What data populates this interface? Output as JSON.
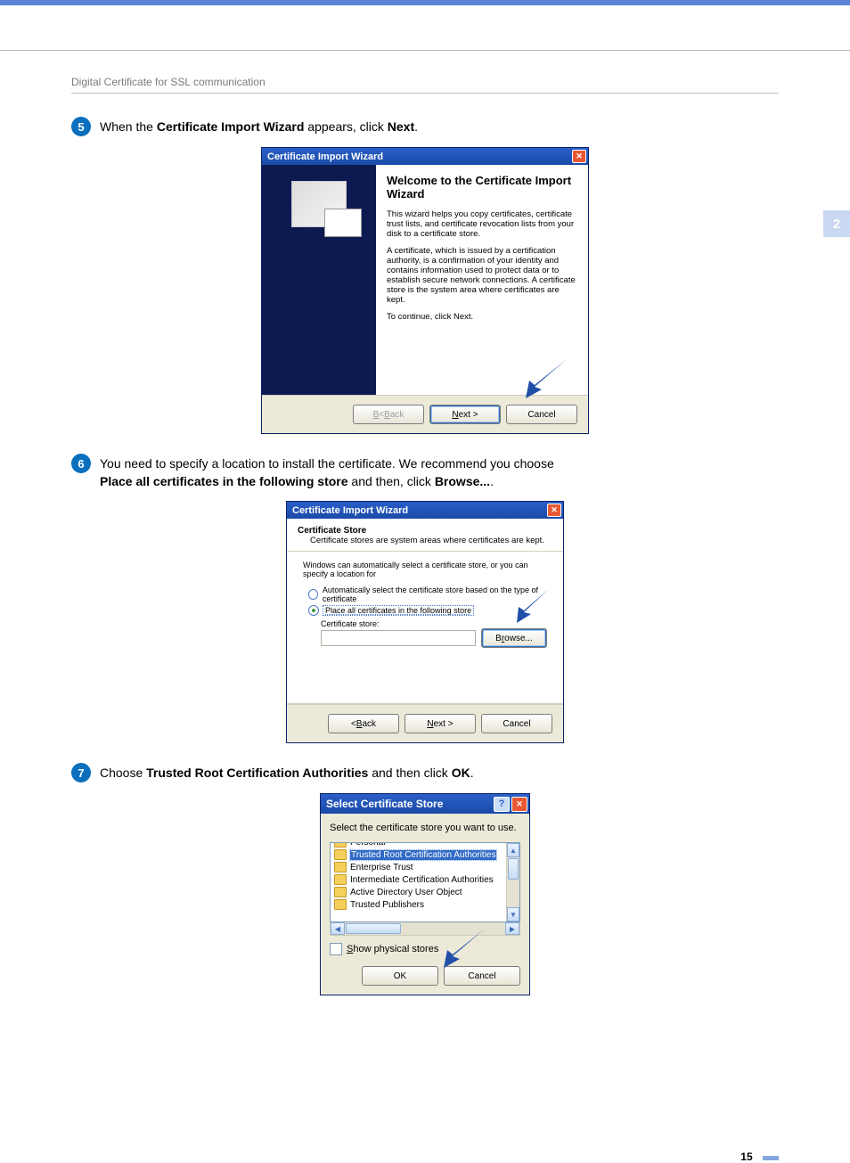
{
  "page": {
    "section_header": "Digital Certificate for SSL communication",
    "side_tab": "2",
    "page_number": "15"
  },
  "step5": {
    "number": "5",
    "prefix": "When the ",
    "bold1": "Certificate Import Wizard",
    "mid": " appears, click ",
    "bold2": "Next",
    "suffix": "."
  },
  "wizard1": {
    "title": "Certificate Import Wizard",
    "heading_line1": "Welcome to the Certificate Import",
    "heading_line2": "Wizard",
    "para1": "This wizard helps you copy certificates, certificate trust lists, and certificate revocation lists from your disk to a certificate store.",
    "para2": "A certificate, which is issued by a certification authority, is a confirmation of your identity and contains information used to protect data or to establish secure network connections. A certificate store is the system area where certificates are kept.",
    "para3": "To continue, click Next.",
    "btn_back": "< Back",
    "btn_next": "Next >",
    "btn_cancel": "Cancel"
  },
  "step6": {
    "number": "6",
    "line1a": "You need to specify a location to install the certificate. We recommend you choose ",
    "bold1": "Place all certificates in the following store",
    "mid": " and then, click ",
    "bold2": "Browse...",
    "suffix": "."
  },
  "wizard2": {
    "title": "Certificate Import Wizard",
    "header": "Certificate Store",
    "subheader": "Certificate stores are system areas where certificates are kept.",
    "intro": "Windows can automatically select a certificate store, or you can specify a location for",
    "radio1": "Automatically select the certificate store based on the type of certificate",
    "radio2": "Place all certificates in the following store",
    "store_label": "Certificate store:",
    "btn_browse": "Browse...",
    "btn_back": "< Back",
    "btn_next": "Next >",
    "btn_cancel": "Cancel"
  },
  "step7": {
    "number": "7",
    "prefix": "Choose ",
    "bold1": "Trusted Root Certification Authorities",
    "mid": " and then click ",
    "bold2": "OK",
    "suffix": "."
  },
  "dialog3": {
    "title": "Select Certificate Store",
    "prompt": "Select the certificate store you want to use.",
    "items": {
      "i0": "Personal",
      "i1": "Trusted Root Certification Authorities",
      "i2": "Enterprise Trust",
      "i3": "Intermediate Certification Authorities",
      "i4": "Active Directory User Object",
      "i5": "Trusted Publishers"
    },
    "checkbox": "Show physical stores",
    "btn_ok": "OK",
    "btn_cancel": "Cancel"
  }
}
